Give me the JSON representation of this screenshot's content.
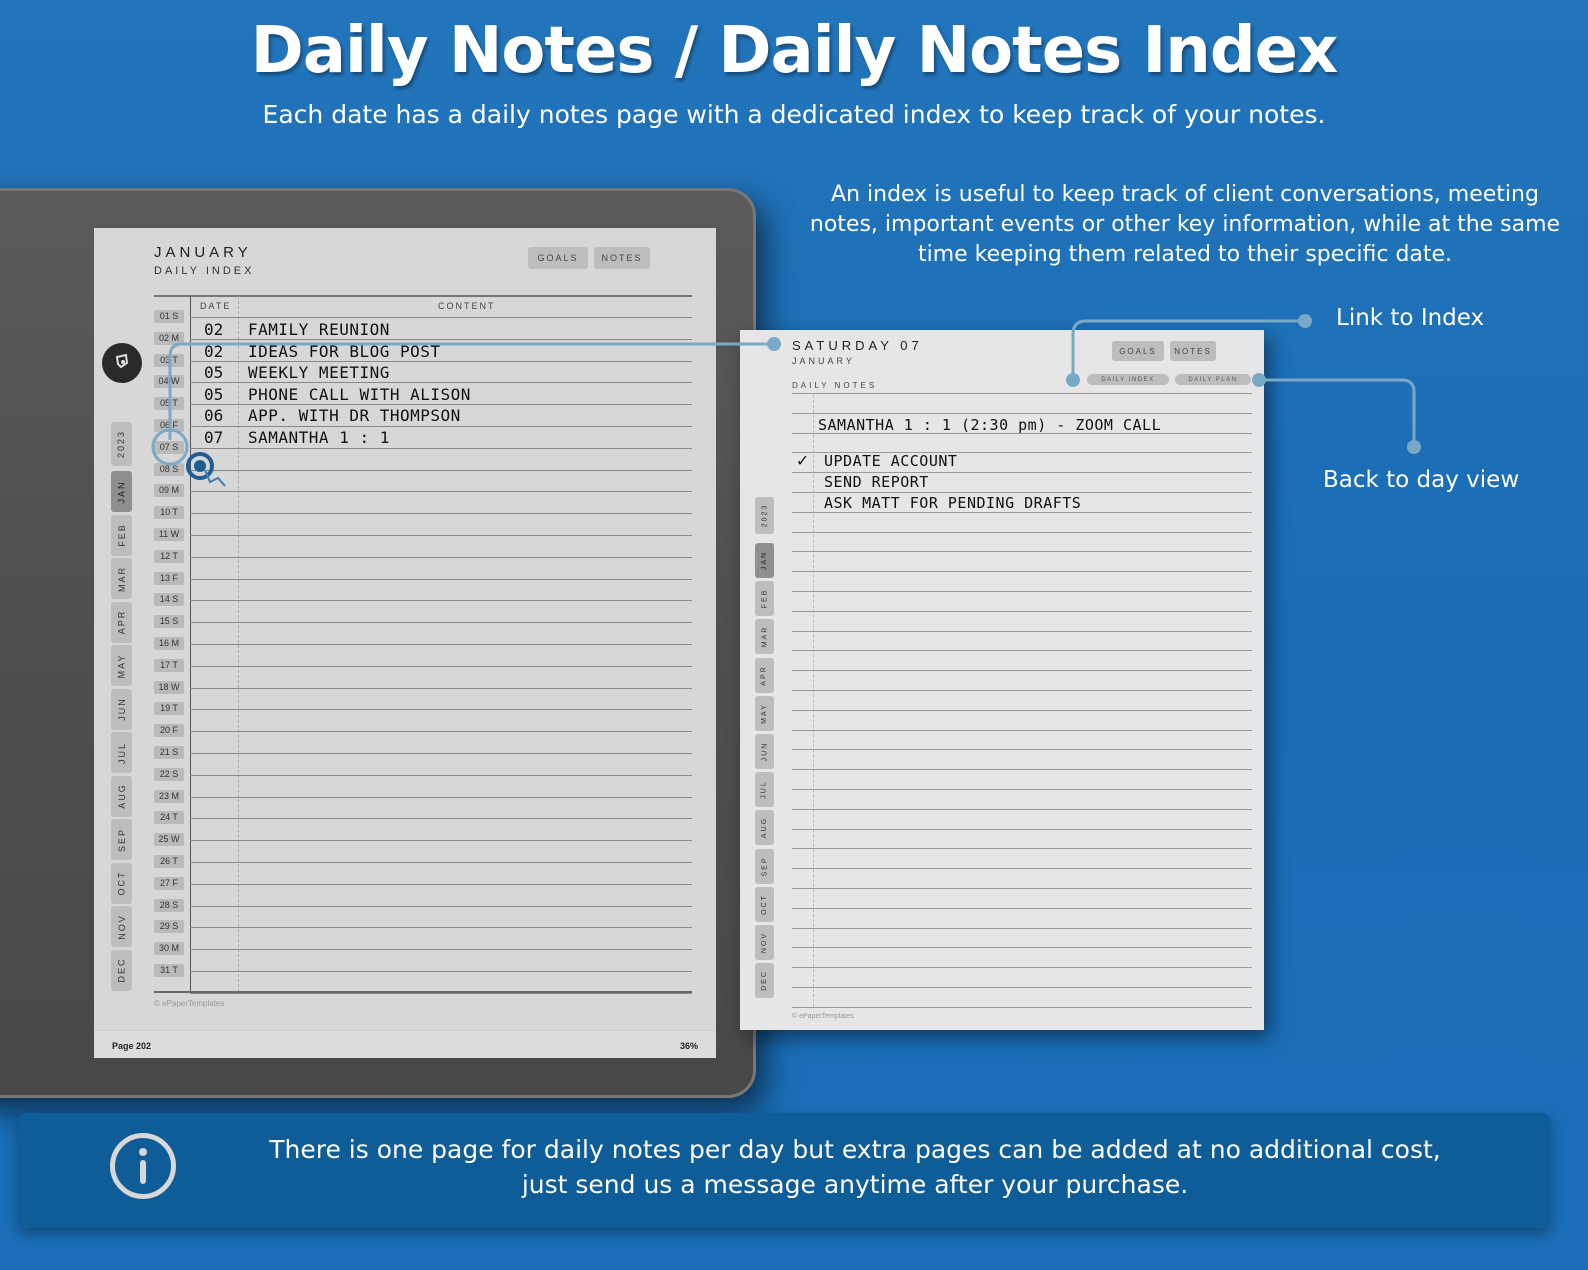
{
  "header": {
    "title": "Daily Notes / Daily Notes Index",
    "subtitle": "Each date has a daily notes page with a dedicated index to keep track of your notes."
  },
  "description": {
    "line1": "An index is useful to keep track of client conversations, meeting",
    "line2": "notes,  important events or other key information, while at the same",
    "line3": "time keeping them related to their specific date."
  },
  "callouts": {
    "link_to_index": "Link to Index",
    "back_to_day_view": "Back to day view"
  },
  "device": {
    "page_number": "Page 202",
    "progress_percent": "36%",
    "pen_icon": "pen-tool-icon"
  },
  "index_page": {
    "month": "JANUARY",
    "subtitle": "DAILY INDEX",
    "buttons": {
      "goals": "GOALS",
      "notes": "NOTES"
    },
    "columns": {
      "date": "DATE",
      "content": "CONTENT"
    },
    "entries": [
      {
        "date": "02",
        "content": "FAMILY REUNION"
      },
      {
        "date": "02",
        "content": "IDEAS FOR BLOG POST"
      },
      {
        "date": "05",
        "content": "WEEKLY MEETING"
      },
      {
        "date": "05",
        "content": "PHONE CALL WITH ALISON"
      },
      {
        "date": "06",
        "content": "APP. WITH DR THOMPSON"
      },
      {
        "date": "07",
        "content": "SAMANTHA 1 : 1"
      }
    ],
    "days": [
      "01 S",
      "02 M",
      "03 T",
      "04 W",
      "05 T",
      "06 F",
      "07 S",
      "08 S",
      "09 M",
      "10 T",
      "11 W",
      "12 T",
      "13 F",
      "14 S",
      "15 S",
      "16 M",
      "17 T",
      "18 W",
      "19 T",
      "20 F",
      "21 S",
      "22 S",
      "23 M",
      "24 T",
      "25 W",
      "26 T",
      "27 F",
      "28 S",
      "29 S",
      "30 M",
      "31 T"
    ],
    "selected_day": "07 S",
    "year_tab": "2023",
    "months": [
      "JAN",
      "FEB",
      "MAR",
      "APR",
      "MAY",
      "JUN",
      "JUL",
      "AUG",
      "SEP",
      "OCT",
      "NOV",
      "DEC"
    ],
    "active_month": "JAN",
    "copyright": "© ePaperTemplates"
  },
  "notes_page": {
    "day": "SATURDAY 07",
    "month": "JANUARY",
    "section": "DAILY NOTES",
    "buttons": {
      "goals": "GOALS",
      "notes": "NOTES",
      "daily_index": "DAILY INDEX",
      "daily_plan": "DAILY PLAN"
    },
    "lines": [
      {
        "text": "SAMANTHA 1 : 1  (2:30 pm)  - ZOOM CALL",
        "checked": false
      },
      {
        "text": "UPDATE ACCOUNT",
        "checked": true
      },
      {
        "text": "SEND REPORT",
        "checked": false
      },
      {
        "text": "ASK MATT FOR PENDING DRAFTS",
        "checked": false
      }
    ],
    "check_mark": "✓",
    "year_tab": "2023",
    "months": [
      "JAN",
      "FEB",
      "MAR",
      "APR",
      "MAY",
      "JUN",
      "JUL",
      "AUG",
      "SEP",
      "OCT",
      "NOV",
      "DEC"
    ],
    "active_month": "JAN",
    "copyright": "© ePaperTemplates"
  },
  "info": {
    "line1": "There is one page for daily notes per day but extra pages can be added at no additional cost,",
    "line2": "just send us a message anytime after your purchase."
  },
  "colors": {
    "background": "#1a6cb4",
    "connector": "#7aa9c8",
    "tap_indicator": "#1f5f96",
    "banner": "#0e5c98"
  }
}
